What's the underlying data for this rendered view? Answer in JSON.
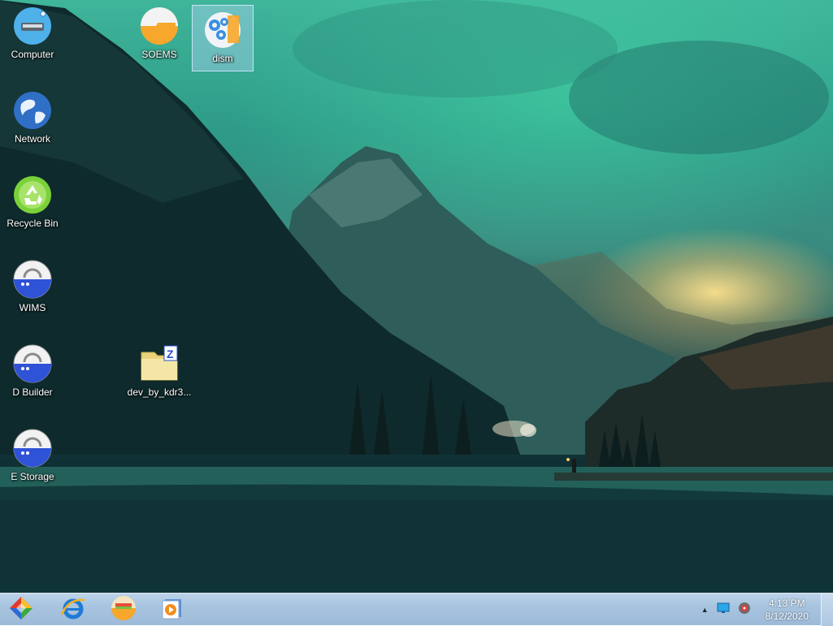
{
  "desktop": {
    "icons": [
      {
        "label": "Computer",
        "icon": "computer-icon"
      },
      {
        "label": "Network",
        "icon": "network-globe-icon"
      },
      {
        "label": "Recycle Bin",
        "icon": "recycle-bin-icon"
      },
      {
        "label": "WIMS",
        "icon": "drive-icon"
      },
      {
        "label": "D Builder",
        "icon": "drive-icon"
      },
      {
        "label": "E Storage",
        "icon": "drive-icon"
      },
      {
        "label": "SOEMS",
        "icon": "folder-icon"
      },
      {
        "label": "dism",
        "icon": "dism-gears-icon",
        "selected": true
      },
      {
        "label": "dev_by_kdr3...",
        "icon": "zip-folder-icon"
      }
    ]
  },
  "taskbar": {
    "start": {
      "icon": "start-diamond-icon"
    },
    "pinned": [
      {
        "name": "internet-explorer",
        "icon": "ie-icon"
      },
      {
        "name": "file-explorer",
        "icon": "explorer-icon"
      },
      {
        "name": "media-player",
        "icon": "media-player-icon"
      }
    ],
    "tray": {
      "icons": [
        "show-hidden-arrow-icon",
        "display-icon",
        "speaker-icon"
      ]
    },
    "clock": {
      "time": "4:13 PM",
      "date": "8/12/2020"
    }
  },
  "colors": {
    "taskbar": "#a8c4df",
    "sky": "#3fb59a",
    "drive_blue": "#2f53d6",
    "folder_orange": "#f7a72b",
    "recycle_green": "#7ad13a"
  }
}
